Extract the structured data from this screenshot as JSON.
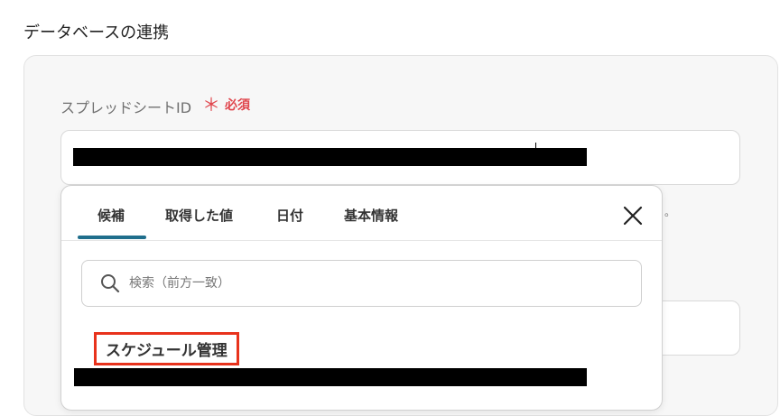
{
  "section": {
    "title": "データベースの連携"
  },
  "field": {
    "label": "スプレッドシートID",
    "required_mark": "＊",
    "required_text": "必須",
    "hint_tail": "。"
  },
  "dropdown": {
    "tabs": [
      {
        "label": "候補",
        "active": true
      },
      {
        "label": "取得した値",
        "active": false
      },
      {
        "label": "日付",
        "active": false
      },
      {
        "label": "基本情報",
        "active": false
      }
    ],
    "close_icon": "close-icon",
    "search": {
      "placeholder": "検索（前方一致）",
      "icon": "search-icon"
    },
    "items": [
      {
        "label": "スケジュール管理"
      }
    ]
  },
  "colors": {
    "required": "#e0454c",
    "tab_underline": "#1f6e8c",
    "highlight_border": "#e8321c"
  }
}
